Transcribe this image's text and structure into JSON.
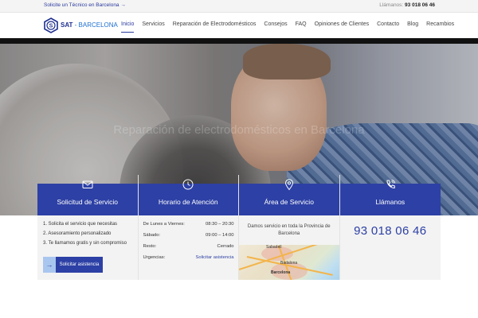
{
  "topbar": {
    "cta": "Solicite un Técnico en Barcelona →",
    "call_label": "Llámanos:",
    "phone": "93 018 06 46"
  },
  "logo": {
    "text": "SAT",
    "suffix": "- BARCELONA"
  },
  "nav": [
    "Inicio",
    "Servicios",
    "Reparación de Electrodomésticos",
    "Consejos",
    "FAQ",
    "Opiniones de Clientes",
    "Contacto",
    "Blog",
    "Recambios"
  ],
  "hero": {
    "tagline": "Reparación de electrodomésticos en Barcelona"
  },
  "features": {
    "solicitud": {
      "title": "Solicitud de Servicio",
      "steps": [
        "1. Solicita el servicio que necesitas",
        "2. Asesoramiento personalizado",
        "3. Te llamamos gratis y sin compromiso"
      ],
      "button": "Solicitar asistencia"
    },
    "horario": {
      "title": "Horario de Atención",
      "rows": [
        {
          "day": "De Lunes a Viernes:",
          "time": "08:30 – 20:30"
        },
        {
          "day": "Sábado:",
          "time": "09:00 – 14:00"
        },
        {
          "day": "Resto:",
          "time": "Cerrado"
        },
        {
          "day": "Urgencias:",
          "time": "Solicitar asistencia"
        }
      ]
    },
    "area": {
      "title": "Área de Servicio",
      "text": "Damos servicio en toda la Provincia de Barcelona",
      "map_labels": [
        "Sabadell",
        "Badalona",
        "Barcelona"
      ]
    },
    "llamanos": {
      "title": "Llámanos",
      "phone": "93 018 06 46"
    }
  },
  "colors": {
    "primary": "#2d40a5",
    "accent": "#a9c6ef"
  }
}
